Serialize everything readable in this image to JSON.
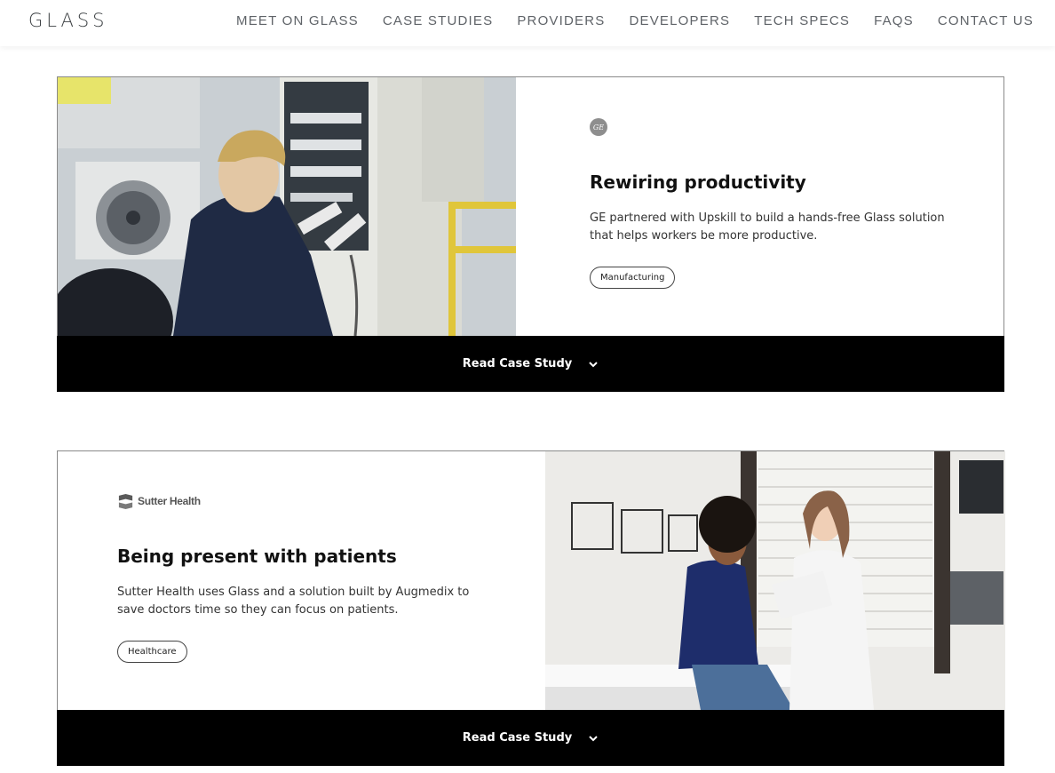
{
  "header": {
    "logo": "GLASS",
    "nav": [
      {
        "label": "MEET ON GLASS"
      },
      {
        "label": "CASE STUDIES"
      },
      {
        "label": "PROVIDERS"
      },
      {
        "label": "DEVELOPERS"
      },
      {
        "label": "TECH SPECS"
      },
      {
        "label": "FAQS"
      },
      {
        "label": "CONTACT US"
      }
    ]
  },
  "cards": [
    {
      "brand": "GE",
      "title": "Rewiring productivity",
      "description": "GE partnered with Upskill to build a hands-free Glass solution that helps workers be more productive.",
      "tag": "Manufacturing",
      "cta": "Read Case Study"
    },
    {
      "brand": "Sutter Health",
      "title": "Being present with patients",
      "description": "Sutter Health uses Glass and a solution built by Augmedix to save doctors time so they can focus on patients.",
      "tag": "Healthcare",
      "cta": "Read Case Study"
    }
  ],
  "icons": {
    "cta": "chevron-down-icon",
    "ge_logo": "ge-logo-icon",
    "sutter_logo": "sutter-health-logo-icon"
  }
}
